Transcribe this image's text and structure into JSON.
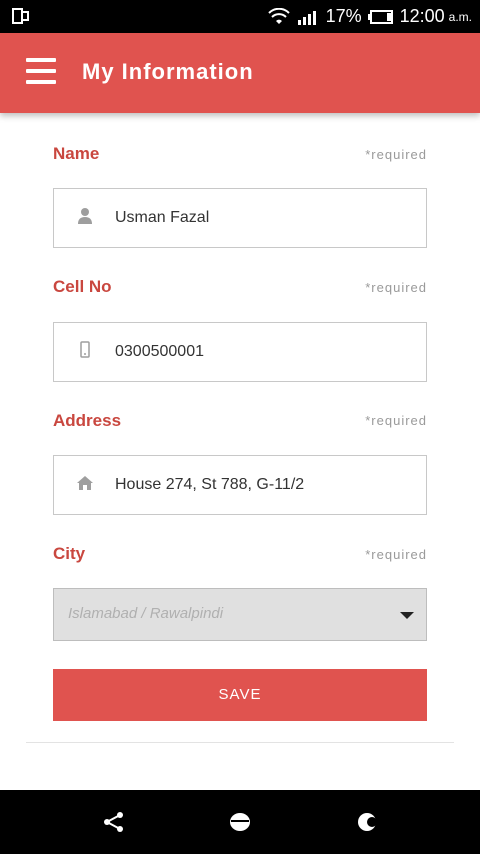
{
  "status_bar": {
    "battery": "17%",
    "time": "12:00",
    "ampm": "a.m.",
    "icons": [
      "phone-frame-icon",
      "wifi-icon",
      "signal-icon",
      "battery-icon"
    ]
  },
  "app_bar": {
    "title": "My Information",
    "menu_icon": "hamburger-menu-icon",
    "color": "#e0534f"
  },
  "form": {
    "required_text": "*required",
    "name": {
      "label": "Name",
      "value": "Usman Fazal",
      "icon": "user-icon"
    },
    "cell": {
      "label": "Cell No",
      "value": "0300500001",
      "icon": "mobile-phone-icon"
    },
    "address": {
      "label": "Address",
      "value": "House 274, St 788, G-11/2",
      "icon": "home-icon"
    },
    "city": {
      "label": "City",
      "value": "Islamabad / Rawalpindi",
      "icon": "dropdown-caret-icon"
    },
    "save_label": "SAVE"
  },
  "nav_bar": {
    "icons": [
      "share-icon",
      "home-circle-icon",
      "recent-apps-icon"
    ]
  }
}
